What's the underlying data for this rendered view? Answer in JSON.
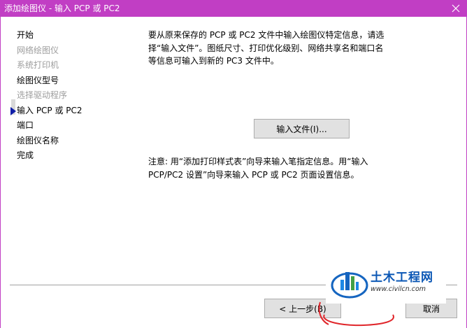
{
  "window": {
    "title": "添加绘图仪 - 输入 PCP 或 PC2",
    "close_icon": "close-icon",
    "accent_color": "#c13ec4"
  },
  "nav": {
    "items": [
      {
        "label": "开始",
        "state": "normal"
      },
      {
        "label": "网络绘图仪",
        "state": "disabled"
      },
      {
        "label": "系统打印机",
        "state": "disabled"
      },
      {
        "label": "绘图仪型号",
        "state": "normal"
      },
      {
        "label": "选择驱动程序",
        "state": "disabled"
      },
      {
        "label": "输入 PCP 或 PC2",
        "state": "current"
      },
      {
        "label": "端口",
        "state": "normal"
      },
      {
        "label": "绘图仪名称",
        "state": "normal"
      },
      {
        "label": "完成",
        "state": "normal"
      }
    ]
  },
  "content": {
    "description": "要从原来保存的 PCP 或 PC2 文件中输入绘图仪特定信息，请选\n择“输入文件”。图纸尺寸、打印优化级别、网络共享名和端口名\n等信息可输入到新的 PC3 文件中。",
    "import_button": "输入文件(I)...",
    "note": "注意: 用“添加打印样式表”向导来输入笔指定信息。用“输入\nPCP/PC2 设置”向导来输入 PCP 或 PC2 页面设置信息。"
  },
  "footer": {
    "back_button": "< 上一步(B)",
    "cancel_button": "取消"
  },
  "watermark": {
    "name": "土木工程网",
    "url": "www.civilcn.com"
  }
}
